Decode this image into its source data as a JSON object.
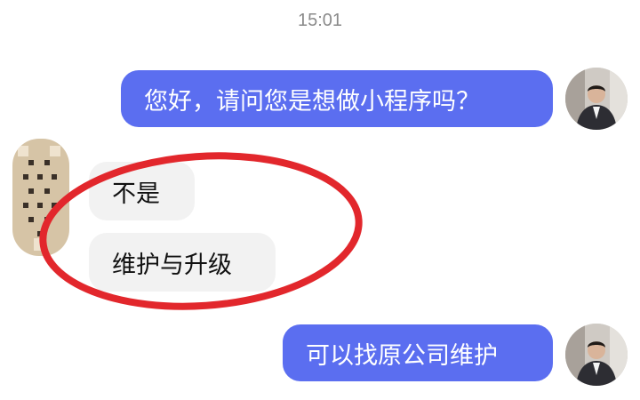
{
  "chat": {
    "timestamp": "15:01",
    "messages": [
      {
        "direction": "outgoing",
        "text": "您好，请问您是想做小程序吗？"
      },
      {
        "direction": "incoming",
        "text": "不是"
      },
      {
        "direction": "incoming",
        "text": "维护与升级"
      },
      {
        "direction": "outgoing",
        "text": "可以找原公司维护"
      }
    ]
  },
  "colors": {
    "outgoing_bubble": "#5b6ef0",
    "incoming_bubble": "#f2f2f2",
    "annotation": "#e2272c"
  },
  "icons": {
    "self_avatar": "user-photo-avatar",
    "contact_avatar": "pixelated-avatar",
    "annotation": "red-highlight-ellipse"
  }
}
